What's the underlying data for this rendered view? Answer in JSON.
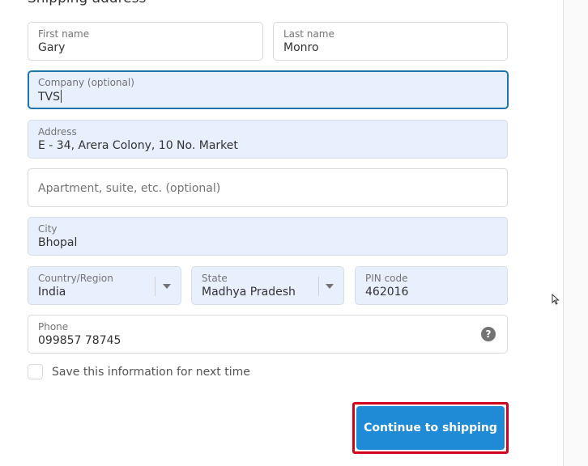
{
  "section": {
    "title": "Shipping address"
  },
  "form": {
    "first_name": {
      "label": "First name",
      "value": "Gary"
    },
    "last_name": {
      "label": "Last name",
      "value": "Monro"
    },
    "company": {
      "label": "Company (optional)",
      "value": "TVS"
    },
    "address": {
      "label": "Address",
      "value": "E - 34, Arera Colony, 10 No. Market"
    },
    "apartment": {
      "placeholder": "Apartment, suite, etc. (optional)"
    },
    "city": {
      "label": "City",
      "value": "Bhopal"
    },
    "country": {
      "label": "Country/Region",
      "value": "India"
    },
    "state": {
      "label": "State",
      "value": "Madhya Pradesh"
    },
    "pin": {
      "label": "PIN code",
      "value": "462016"
    },
    "phone": {
      "label": "Phone",
      "value": "099857 78745"
    },
    "save_info": {
      "label": "Save this information for next time",
      "checked": false
    }
  },
  "actions": {
    "continue_label": "Continue to shipping"
  },
  "icons": {
    "help": "question-circle-icon",
    "dropdown": "chevron-down-icon",
    "cursor": "mouse-pointer-icon"
  },
  "colors": {
    "accent": "#1f8ad6",
    "focus_border": "#1e73a8",
    "autofill_bg": "#e8f0fe",
    "highlight_border": "#d0021b"
  }
}
